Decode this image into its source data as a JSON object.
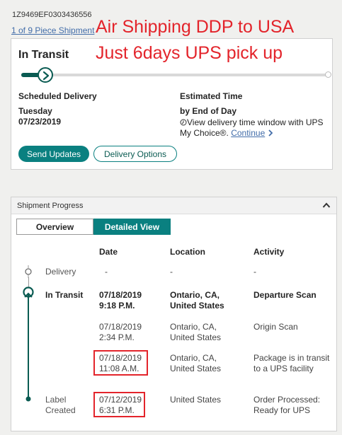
{
  "tracking_number": "1Z9469EF0303436556",
  "piece_link": "1 of 9 Piece Shipment",
  "overlay": {
    "line1": "Air Shipping DDP to USA",
    "line2": "Just 6days UPS pick up"
  },
  "status_card": {
    "title": "In Transit",
    "progress_fraction": 0.08,
    "scheduled_label": "Scheduled Delivery",
    "scheduled_day": "Tuesday",
    "scheduled_date": "07/23/2019",
    "estimated_label": "Estimated Time",
    "estimated_value": "by End of Day",
    "window_text": "View delivery time window with UPS My Choice®.",
    "continue_link": "Continue",
    "send_updates": "Send Updates",
    "delivery_options": "Delivery Options"
  },
  "progress_panel": {
    "title": "Shipment Progress",
    "tab_overview": "Overview",
    "tab_detailed": "Detailed View",
    "columns": {
      "date": "Date",
      "location": "Location",
      "activity": "Activity"
    },
    "rows": [
      {
        "status": "Delivery",
        "date": "-",
        "time": "",
        "location": "-",
        "activity": "-"
      },
      {
        "status": "In Transit",
        "date": "07/18/2019",
        "time": "9:18 P.M.",
        "location": "Ontario, CA, United States",
        "activity": "Departure Scan"
      },
      {
        "status": "",
        "date": "07/18/2019",
        "time": "2:34 P.M.",
        "location": "Ontario, CA, United States",
        "activity": "Origin Scan"
      },
      {
        "status": "",
        "date": "07/18/2019",
        "time": "11:08 A.M.",
        "location": "Ontario, CA, United States",
        "activity": "Package is in transit to a UPS facility"
      },
      {
        "status": "Label Created",
        "date": "07/12/2019",
        "time": "6:31 P.M.",
        "location": "United States",
        "activity": "Order Processed: Ready for UPS"
      }
    ]
  },
  "colors": {
    "accent": "#0a8080",
    "dark_green": "#0a5b52",
    "overlay_red": "#e3242b",
    "link_blue": "#426da9"
  },
  "icons": {
    "progress_marker": "chevron-right-icon",
    "info": "clock-icon",
    "continue": "chevron-right-icon",
    "collapse": "chevron-up-icon"
  }
}
